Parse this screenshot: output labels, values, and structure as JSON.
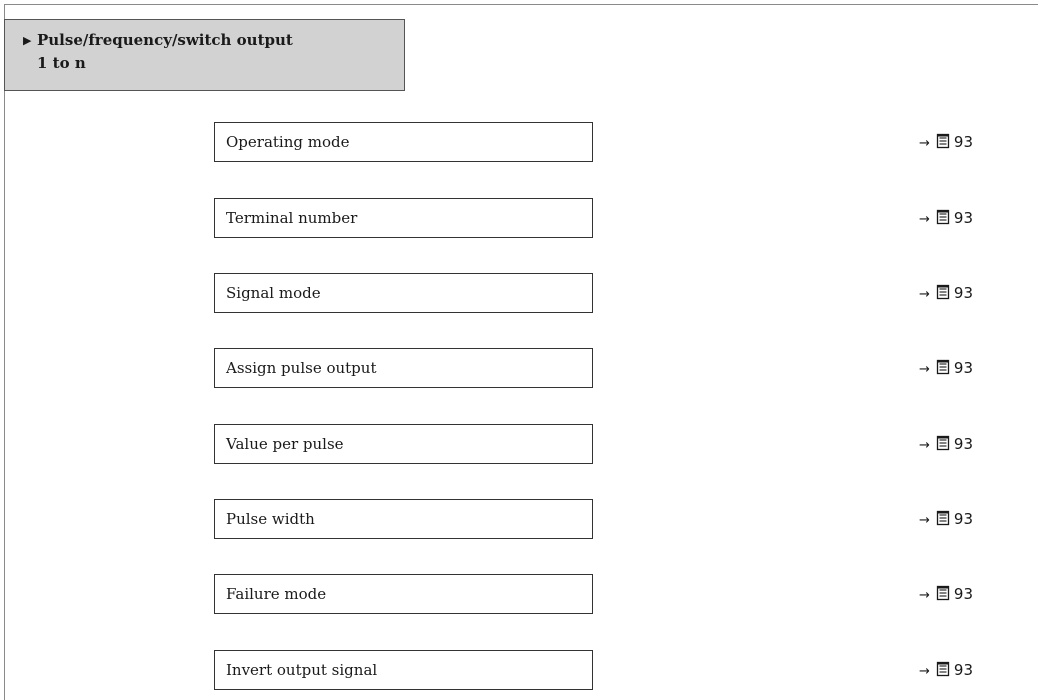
{
  "submenu": {
    "arrow": "▶",
    "title_line1": "Pulse/frequency/switch output",
    "title_line2": "1 to n"
  },
  "parameters": [
    {
      "label": "Operating mode",
      "ref_arrow": "→",
      "page": "93"
    },
    {
      "label": "Terminal number",
      "ref_arrow": "→",
      "page": "93"
    },
    {
      "label": "Signal mode",
      "ref_arrow": "→",
      "page": "93"
    },
    {
      "label": "Assign pulse output",
      "ref_arrow": "→",
      "page": "93"
    },
    {
      "label": "Value per pulse",
      "ref_arrow": "→",
      "page": "93"
    },
    {
      "label": "Pulse width",
      "ref_arrow": "→",
      "page": "93"
    },
    {
      "label": "Failure mode",
      "ref_arrow": "→",
      "page": "93"
    },
    {
      "label": "Invert output signal",
      "ref_arrow": "→",
      "page": "93"
    }
  ],
  "icons": {
    "page_reference": "book-page-icon"
  }
}
